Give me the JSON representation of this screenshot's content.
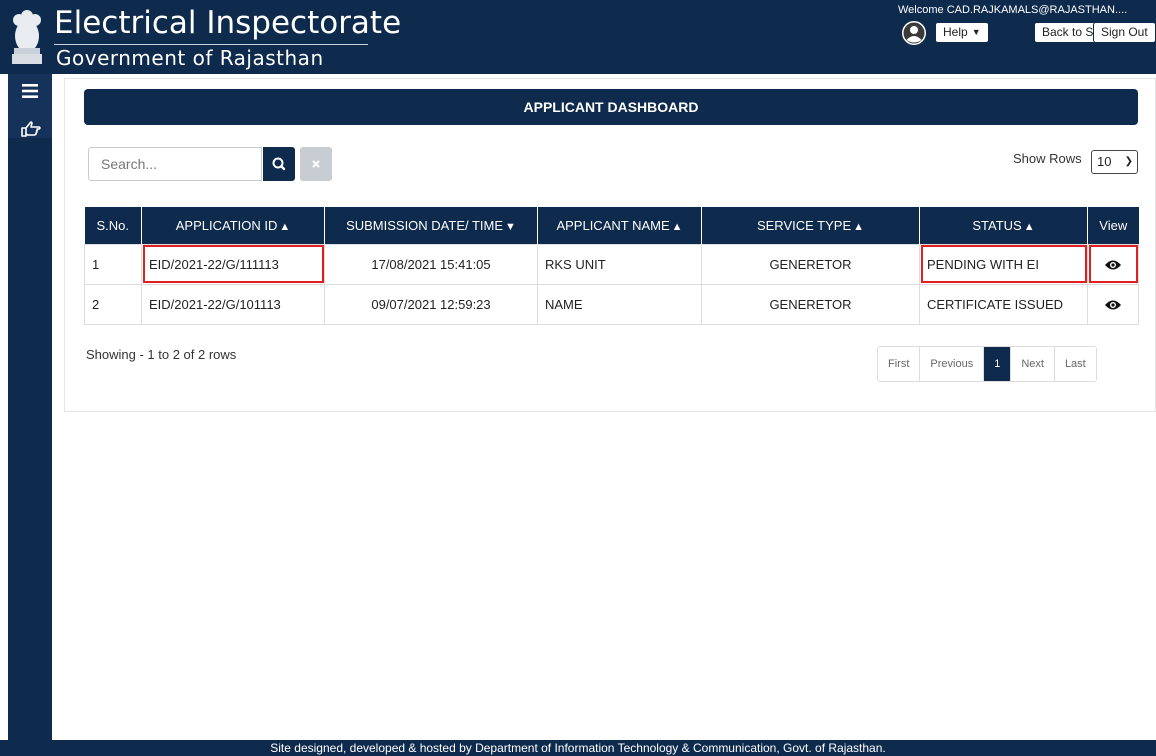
{
  "header": {
    "title": "Electrical Inspectorate",
    "subtitle": "Government of Rajasthan",
    "welcome": "Welcome CAD.RAJKAMALS@RAJASTHAN....",
    "help_label": "Help",
    "back_to_sso_label": "Back to SSO",
    "sign_out_label": "Sign Out"
  },
  "dashboard": {
    "title": "APPLICANT DASHBOARD",
    "search_placeholder": "Search...",
    "show_rows_label": "Show Rows",
    "rows_value": "10"
  },
  "table": {
    "headers": {
      "sno": "S.No.",
      "app_id": "APPLICATION ID",
      "date": "SUBMISSION DATE/ TIME",
      "name": "APPLICANT NAME",
      "service": "SERVICE TYPE",
      "status": "STATUS",
      "view": "View"
    },
    "rows": [
      {
        "sno": "1",
        "app_id": "EID/2021-22/G/111113",
        "date": "17/08/2021 15:41:05",
        "name": "RKS UNIT",
        "service": "GENERETOR",
        "status": "PENDING WITH EI"
      },
      {
        "sno": "2",
        "app_id": "EID/2021-22/G/101113",
        "date": "09/07/2021 12:59:23",
        "name": "NAME",
        "service": "GENERETOR",
        "status": "CERTIFICATE ISSUED"
      }
    ]
  },
  "pagination": {
    "summary": "Showing - 1 to 2 of 2 rows",
    "first": "First",
    "previous": "Previous",
    "current": "1",
    "next": "Next",
    "last": "Last"
  },
  "footer": {
    "text": "Site designed, developed & hosted by Department of Information Technology & Communication, Govt. of Rajasthan."
  },
  "colors": {
    "primary": "#0e2a4d",
    "highlight": "#e02020"
  },
  "icons": [
    "emblem-icon",
    "user-avatar-icon",
    "menu-icon",
    "hand-pointer-icon",
    "search-icon",
    "close-icon",
    "eye-icon"
  ]
}
